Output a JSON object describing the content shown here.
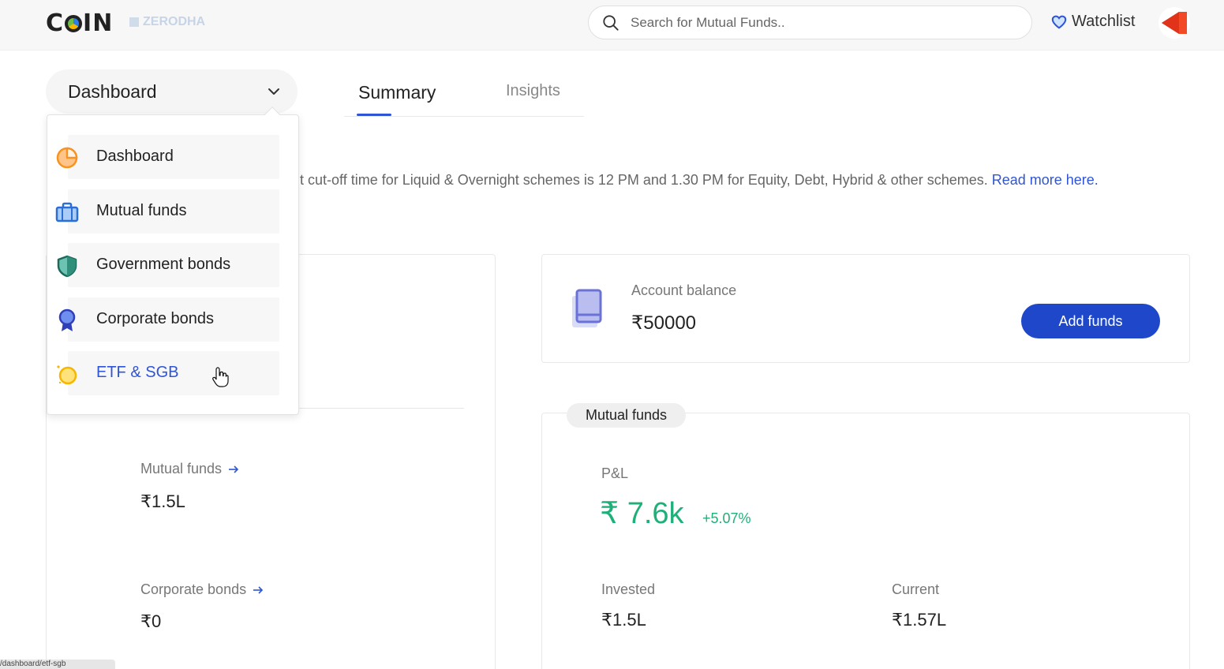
{
  "header": {
    "logo": "COIN",
    "brand_sub": "ZERODHA",
    "search_placeholder": "Search for Mutual Funds..",
    "watchlist_label": "Watchlist"
  },
  "section_select": {
    "current": "Dashboard"
  },
  "tabs": [
    {
      "label": "Summary",
      "active": true
    },
    {
      "label": "Insights",
      "active": false
    }
  ],
  "notice": {
    "text": "t cut-off time for Liquid & Overnight schemes is 12 PM and 1.30 PM for Equity, Debt, Hybrid & other schemes. ",
    "link": "Read more here."
  },
  "dropdown": {
    "items": [
      {
        "label": "Dashboard",
        "icon": "pie-chart-icon"
      },
      {
        "label": "Mutual funds",
        "icon": "briefcase-icon"
      },
      {
        "label": "Government bonds",
        "icon": "shield-icon"
      },
      {
        "label": "Corporate bonds",
        "icon": "ribbon-badge-icon"
      },
      {
        "label": "ETF & SGB",
        "icon": "gold-coin-icon",
        "active": true
      }
    ]
  },
  "holdings": [
    {
      "label": "Mutual funds",
      "value": "₹1.5L"
    },
    {
      "label": "Corporate bonds",
      "value": "₹0"
    }
  ],
  "account": {
    "label": "Account balance",
    "value": "₹50000",
    "add_funds_label": "Add funds"
  },
  "mutual_funds": {
    "chip": "Mutual funds",
    "pl_label": "P&L",
    "pl_value": "₹ 7.6k",
    "pl_pct": "+5.07%",
    "invested_label": "Invested",
    "invested_value": "₹1.5L",
    "current_label": "Current",
    "current_value": "₹1.57L"
  },
  "status_bar": "/dashboard/etf-sgb",
  "colors": {
    "accent": "#2f55d4",
    "button": "#1f47c9",
    "profit": "#1fb07a"
  }
}
